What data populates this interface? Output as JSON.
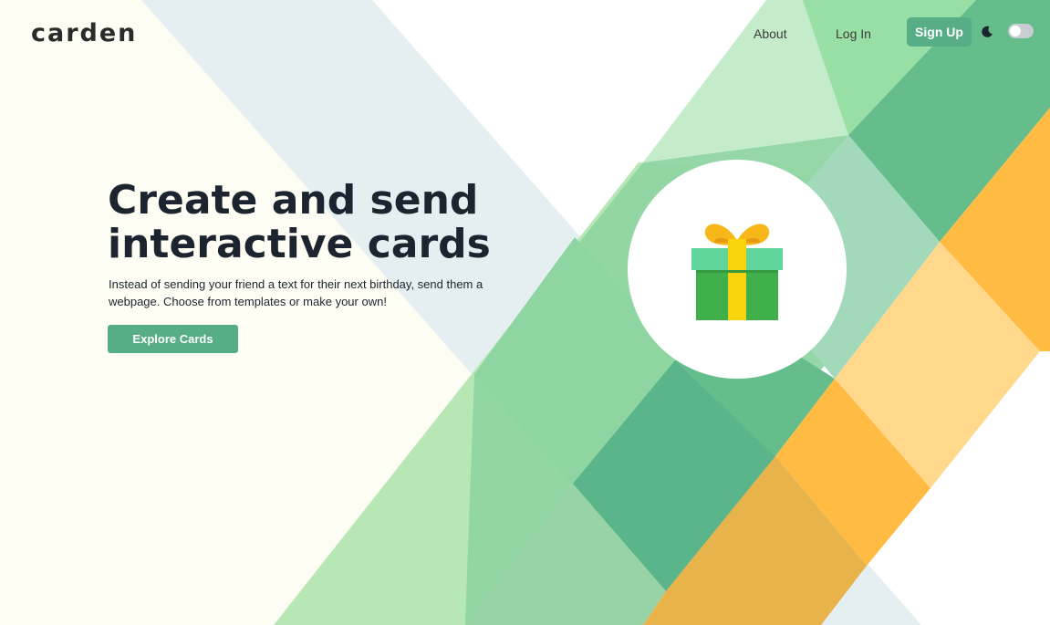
{
  "brand": {
    "logo_text": "carden"
  },
  "nav": {
    "about_label": "About",
    "login_label": "Log In",
    "signup_label": "Sign Up",
    "theme_icon": "moon-icon",
    "theme_toggle_state": "off"
  },
  "hero": {
    "title_line1": "Create and send",
    "title_line2": "interactive cards",
    "subtitle": "Instead of sending your friend a text for their next birthday, send them a webpage. Choose from templates or make your own!",
    "cta_label": "Explore Cards",
    "illustration_icon": "gift-icon"
  },
  "colors": {
    "accent": "#57ad86",
    "text_dark": "#1c2430",
    "cream": "#fefdf3",
    "light_blue": "#e5eef1",
    "green_light": "#b8e7b6",
    "green_mid": "#8fd5a2",
    "green_dark": "#5bb58a",
    "orange": "#ffbb42",
    "orange_light": "#ffd88c"
  }
}
